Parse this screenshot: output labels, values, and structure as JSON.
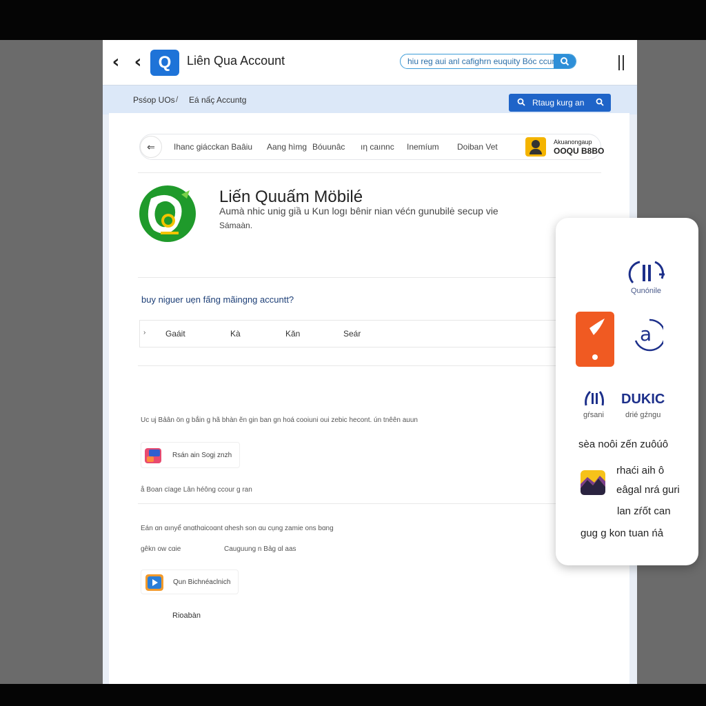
{
  "titlebar": {
    "app_logo_letter": "Q",
    "title": "Liên Qua Account",
    "search_value": "hiu reg aui anl cafighrn euquity Bóc ccurn",
    "search_icon": "search-icon",
    "back_icon": "chevron-left-icon"
  },
  "breadcrumb": {
    "items": [
      "Psśop UOs",
      "Eá nấç Accuntg"
    ],
    "separator": "/"
  },
  "action_button": {
    "label": "Rtaug kurg an"
  },
  "tabs": [
    "Ihanc giácckan Baâiu",
    "Aang hìmg",
    "Bóuunâc",
    "ıη caınnc",
    "Inemíum",
    "Doiban Vet"
  ],
  "profile": {
    "name": "Akuanongaup",
    "code": "OOQU B8BO"
  },
  "game": {
    "title": "Liến Quuấm Möbilé",
    "description": "Aumà nhic unig giầ u Kun logı bênir nian véćn gunubilė secup vie",
    "description2": "Sámaàn."
  },
  "question": {
    "text": "buy niguer uẹn fấng mãingng accuntt?",
    "choices": [
      "Gaáit",
      "Kà",
      "Kǎn",
      "Seár"
    ]
  },
  "texts": {
    "line1": "Uc uj Bảân ön g bắin g hã bhàn ẽn gin ban gn hoá cooiuni oui zebic hecont. ún tnêên auun",
    "item1_label": "Rsán ain Sogị znzh",
    "line2": "å Boan cïage Lân héông ccour g ran",
    "line3": "Eán ɑn ɑınyể ɑnɑthɑicoɑnt ɑhesh son ɑu cụng zamie ons bɑng",
    "line4a": "gêkn ow cɑie",
    "line4b": "Cauguung n Bảg ɑl aas",
    "item2_label": "Qun Bichnéaclnich",
    "bottom": "Rioabàn"
  },
  "side_panel": {
    "brand1_label": "Qunónile",
    "brand2_title": "DUKIC",
    "brand2_sub_a": "gŕsani",
    "brand2_sub_b": "drié gźngu",
    "heading": "sèa noôi zến zuôúô",
    "lines": [
      "rhaći aih ô",
      "eâgal nrá guri",
      "lan zŕốt can",
      "gug g kon tuan ńả"
    ]
  },
  "colors": {
    "accent": "#1f64c8",
    "brand_orange": "#f05a22",
    "game_green": "#1f9a2b",
    "dukic_navy": "#1c2f8a"
  }
}
